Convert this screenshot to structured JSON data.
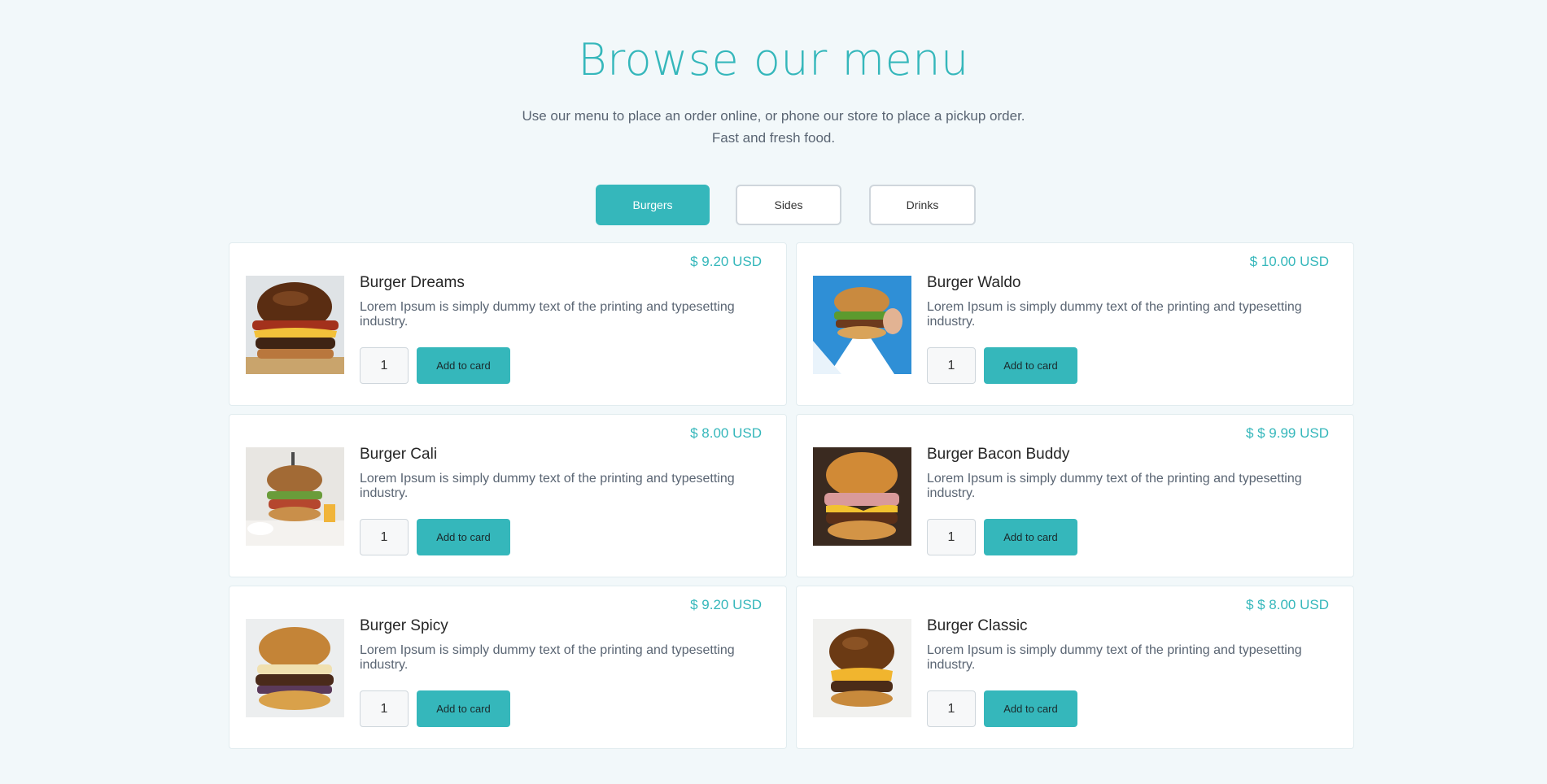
{
  "header": {
    "title": "Browse our menu",
    "subtitle_line1": "Use our menu to place an order online, or phone our store to place a pickup order.",
    "subtitle_line2": "Fast and fresh food."
  },
  "tabs": [
    {
      "label": "Burgers",
      "active": true
    },
    {
      "label": "Sides",
      "active": false
    },
    {
      "label": "Drinks",
      "active": false
    }
  ],
  "colors": {
    "accent": "#35b7bb",
    "background": "#f2f8fa"
  },
  "common": {
    "add_label": "Add to card"
  },
  "items": [
    {
      "name": "Burger Dreams",
      "price": "$ 9.20 USD",
      "description": "Lorem Ipsum is simply dummy text of the printing and typesetting industry.",
      "quantity": "1",
      "image": "burger-dreams-photo"
    },
    {
      "name": "Burger Waldo",
      "price": "$ 10.00 USD",
      "description": "Lorem Ipsum is simply dummy text of the printing and typesetting industry.",
      "quantity": "1",
      "image": "burger-waldo-photo"
    },
    {
      "name": "Burger Cali",
      "price": "$ 8.00 USD",
      "description": "Lorem Ipsum is simply dummy text of the printing and typesetting industry.",
      "quantity": "1",
      "image": "burger-cali-photo"
    },
    {
      "name": "Burger Bacon Buddy",
      "price": "$ $ 9.99 USD",
      "description": "Lorem Ipsum is simply dummy text of the printing and typesetting industry.",
      "quantity": "1",
      "image": "burger-bacon-buddy-photo"
    },
    {
      "name": "Burger Spicy",
      "price": "$ 9.20 USD",
      "description": "Lorem Ipsum is simply dummy text of the printing and typesetting industry.",
      "quantity": "1",
      "image": "burger-spicy-photo"
    },
    {
      "name": "Burger Classic",
      "price": "$ $ 8.00 USD",
      "description": "Lorem Ipsum is simply dummy text of the printing and typesetting industry.",
      "quantity": "1",
      "image": "burger-classic-photo"
    }
  ]
}
